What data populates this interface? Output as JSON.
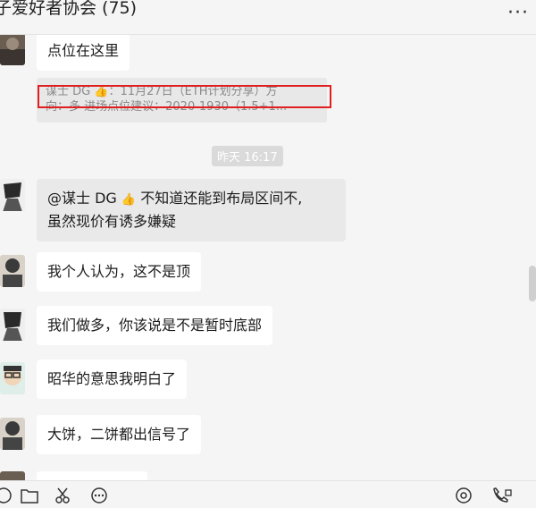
{
  "header": {
    "title": "子爱好者协会 (75)",
    "more": "···"
  },
  "chat": {
    "msg1": "点位在这里",
    "quote_line1": "谋士 DG 👍：11月27日（ETH计划分享）方",
    "quote_line2": "向：多 进场点位建议：2020-1930（1.5+1...",
    "time": "昨天 16:17",
    "msg2_line1_prefix": "@谋士 DG",
    "msg2_line1_suffix": "不知道还能到布局区间不,",
    "msg2_line2": "虽然现价有诱多嫌疑",
    "msg3": "我个人认为，这不是顶",
    "msg4": "我们做多，你该说是不是暂时底部",
    "msg5": "昭华的意思我明白了",
    "msg6": "大饼，二饼都出信号了"
  },
  "icons": [
    "emoji-icon",
    "folder-icon",
    "scissors-icon",
    "more-icon",
    "live-icon",
    "video-call-icon"
  ]
}
